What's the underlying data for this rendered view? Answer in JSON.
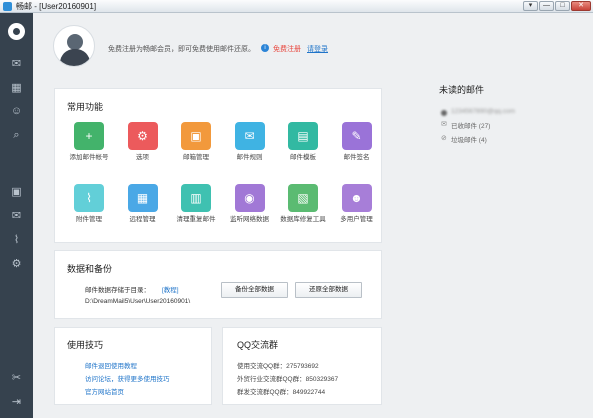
{
  "window": {
    "title": "畅邮 - [User20160901]",
    "buttons": [
      "▾",
      "—",
      "□",
      "✕"
    ]
  },
  "intro": {
    "text": "免费注册为畅邮会员，即可免费使用邮件还原。",
    "register": "免费注册",
    "login": "请登录"
  },
  "functions": {
    "title": "常用功能",
    "items": [
      {
        "label": "添加邮件帐号",
        "color": "#43b36b",
        "icon": "add-account-icon",
        "glyph": "+"
      },
      {
        "label": "选项",
        "color": "#ec5a5c",
        "icon": "gear-icon",
        "glyph": "⚙"
      },
      {
        "label": "邮箱管理",
        "color": "#f2993c",
        "icon": "mailbox-icon",
        "glyph": "▣"
      },
      {
        "label": "邮件规则",
        "color": "#3fb3e3",
        "icon": "mail-rule-icon",
        "glyph": "✉"
      },
      {
        "label": "邮件模板",
        "color": "#32b9a2",
        "icon": "template-icon",
        "glyph": "▤"
      },
      {
        "label": "邮件签名",
        "color": "#9a73d8",
        "icon": "signature-icon",
        "glyph": "✎"
      },
      {
        "label": "附件管理",
        "color": "#62cfd8",
        "icon": "attachment-icon",
        "glyph": "⌇"
      },
      {
        "label": "远程管理",
        "color": "#4aa8e6",
        "icon": "remote-icon",
        "glyph": "▦"
      },
      {
        "label": "清理重复邮件",
        "color": "#3fc1b1",
        "icon": "clean-icon",
        "glyph": "▥"
      },
      {
        "label": "监听网络数据",
        "color": "#a178d6",
        "icon": "monitor-icon",
        "glyph": "◉"
      },
      {
        "label": "数据库修复工具",
        "color": "#5bbb72",
        "icon": "db-repair-icon",
        "glyph": "▧"
      },
      {
        "label": "多用户管理",
        "color": "#a77ed8",
        "icon": "users-icon",
        "glyph": "☻"
      }
    ]
  },
  "data": {
    "title": "数据和备份",
    "storage_label": "邮件数据存储于目录：",
    "help": "[教程]",
    "path": "D:\\DreamMail5\\User\\User20160901\\",
    "backup": "备份全部数据",
    "restore": "还原全部数据"
  },
  "tips": {
    "title": "使用技巧",
    "links": [
      "邮件退回使用教程",
      "访问论坛，获得更多使用技巧",
      "官方网站首页"
    ]
  },
  "qq": {
    "title": "QQ交流群",
    "lines": [
      "使用交流QQ群：275793692",
      "外贸行业交流群QQ群：850329367",
      "群发交流群QQ群：849922744"
    ]
  },
  "unread": {
    "title": "未读的邮件",
    "account": "1234567890@qq.com",
    "inbox": "已收邮件 (27)",
    "spam": "垃圾邮件 (4)"
  }
}
